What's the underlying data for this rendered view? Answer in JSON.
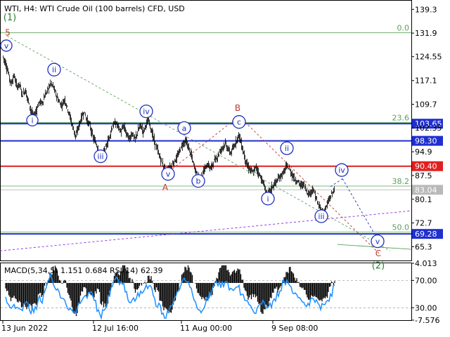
{
  "header": {
    "title": "WTI, H4:  WTI Crude Oil (100 barrels) CFD, USD"
  },
  "colors": {
    "candles": "#000000",
    "grid": "#c8c8c8",
    "fib": "#5aa05a",
    "wave_label": "#2030c0",
    "wave_big": "#2e7d32",
    "corr_label": "#c0392b",
    "blue_level": "#1f2fd0",
    "red_level": "#e02020",
    "macd_hist": "#000000",
    "macd_signal": "#e02020",
    "rsi": "#1e90ff",
    "tag_blue": "#1f2fd0",
    "tag_red": "#e02020",
    "tag_gray": "#b9b9b9"
  },
  "chart_data": [
    {
      "type": "candlestick",
      "title": "WTI, H4:  WTI Crude Oil (100 barrels) CFD, USD",
      "ylim": [
        61,
        142
      ],
      "y_ticks": [
        139.3,
        131.9,
        124.55,
        117.1,
        109.7,
        102.35,
        94.9,
        87.5,
        80.1,
        72.7,
        65.3
      ],
      "x_tick_labels": [
        "13 Jun 2022",
        "12 Jul 16:00",
        "11 Aug 00:00",
        "9 Sep 08:00"
      ],
      "price_path": [
        [
          0,
          124.8
        ],
        [
          4,
          122.5
        ],
        [
          8,
          119.5
        ],
        [
          12,
          116.0
        ],
        [
          16,
          118.8
        ],
        [
          20,
          115.2
        ],
        [
          24,
          116.0
        ],
        [
          28,
          112.5
        ],
        [
          32,
          114.2
        ],
        [
          36,
          111.0
        ],
        [
          40,
          108.0
        ],
        [
          44,
          105.5
        ],
        [
          48,
          108.0
        ],
        [
          52,
          110.5
        ],
        [
          56,
          110.0
        ],
        [
          60,
          112.4
        ],
        [
          64,
          114.2
        ],
        [
          68,
          116.2
        ],
        [
          72,
          115.2
        ],
        [
          76,
          112.6
        ],
        [
          80,
          110.5
        ],
        [
          84,
          109.3
        ],
        [
          88,
          111.3
        ],
        [
          92,
          108.6
        ],
        [
          96,
          105.6
        ],
        [
          100,
          102.4
        ],
        [
          104,
          99.6
        ],
        [
          108,
          102.8
        ],
        [
          112,
          105.6
        ],
        [
          116,
          107.4
        ],
        [
          120,
          104.6
        ],
        [
          124,
          103.1
        ],
        [
          128,
          99.6
        ],
        [
          132,
          97.8
        ],
        [
          136,
          95.8
        ],
        [
          140,
          92.6
        ],
        [
          144,
          94.6
        ],
        [
          148,
          97.0
        ],
        [
          152,
          99.8
        ],
        [
          156,
          102.8
        ],
        [
          160,
          103.9
        ],
        [
          164,
          103.0
        ],
        [
          168,
          101.0
        ],
        [
          172,
          102.9
        ],
        [
          176,
          100.6
        ],
        [
          180,
          98.8
        ],
        [
          184,
          100.8
        ],
        [
          188,
          98.6
        ],
        [
          192,
          101.2
        ],
        [
          196,
          103.2
        ],
        [
          200,
          101.1
        ],
        [
          204,
          103.6
        ],
        [
          208,
          104.6
        ],
        [
          212,
          101.0
        ],
        [
          216,
          97.9
        ],
        [
          220,
          95.6
        ],
        [
          224,
          92.8
        ],
        [
          228,
          90.8
        ],
        [
          232,
          88.6
        ],
        [
          236,
          89.6
        ],
        [
          240,
          90.4
        ],
        [
          244,
          91.9
        ],
        [
          248,
          93.1
        ],
        [
          252,
          95.4
        ],
        [
          256,
          97.4
        ],
        [
          260,
          98.3
        ],
        [
          264,
          96.4
        ],
        [
          268,
          93.9
        ],
        [
          272,
          90.6
        ],
        [
          276,
          88.1
        ],
        [
          280,
          86.6
        ],
        [
          284,
          87.6
        ],
        [
          288,
          89.9
        ],
        [
          292,
          90.9
        ],
        [
          296,
          89.6
        ],
        [
          300,
          91.9
        ],
        [
          304,
          92.8
        ],
        [
          308,
          94.6
        ],
        [
          312,
          96.1
        ],
        [
          316,
          97.5
        ],
        [
          320,
          95.9
        ],
        [
          324,
          94.4
        ],
        [
          328,
          96.0
        ],
        [
          332,
          98.3
        ],
        [
          336,
          100.2
        ],
        [
          340,
          96.8
        ],
        [
          344,
          93.3
        ],
        [
          348,
          90.3
        ],
        [
          352,
          89.3
        ],
        [
          356,
          88.3
        ],
        [
          360,
          90.1
        ],
        [
          364,
          88.4
        ],
        [
          368,
          86.4
        ],
        [
          372,
          84.2
        ],
        [
          376,
          81.2
        ],
        [
          380,
          82.8
        ],
        [
          384,
          84.1
        ],
        [
          388,
          85.3
        ],
        [
          392,
          86.4
        ],
        [
          396,
          87.5
        ],
        [
          400,
          88.6
        ],
        [
          404,
          90.5
        ],
        [
          408,
          89.3
        ],
        [
          412,
          87.6
        ],
        [
          416,
          86.1
        ],
        [
          420,
          85.7
        ],
        [
          424,
          84.3
        ],
        [
          428,
          84.9
        ],
        [
          432,
          82.8
        ],
        [
          436,
          81.6
        ],
        [
          440,
          83.2
        ],
        [
          444,
          81.8
        ],
        [
          448,
          78.6
        ],
        [
          452,
          77.0
        ],
        [
          456,
          75.8
        ],
        [
          460,
          77.6
        ],
        [
          464,
          79.8
        ],
        [
          468,
          81.7
        ],
        [
          472,
          83.4
        ]
      ],
      "fib_levels": [
        {
          "label": "0.0",
          "price": 132.0
        },
        {
          "label": "23.6",
          "price": 104.0
        },
        {
          "label": "38.2",
          "price": 84.2
        },
        {
          "label": "50.0",
          "price": 69.9
        }
      ],
      "horizontal_levels": [
        {
          "price": 103.65,
          "label": "103.65",
          "color": "blue"
        },
        {
          "price": 98.3,
          "label": "98.30",
          "color": "blue"
        },
        {
          "price": 90.4,
          "label": "90.40",
          "color": "red"
        },
        {
          "price": 83.04,
          "label": "83.04",
          "color": "gray"
        },
        {
          "price": 69.28,
          "label": "69.28",
          "color": "blue"
        }
      ],
      "wave_labels": [
        {
          "text": "(1)",
          "style": "big-green"
        },
        {
          "text": "5",
          "style": "red"
        },
        {
          "text": "v",
          "style": "circle"
        },
        {
          "text": "ii",
          "style": "circle"
        },
        {
          "text": "i",
          "style": "circle"
        },
        {
          "text": "iii",
          "style": "circle"
        },
        {
          "text": "iv",
          "style": "circle"
        },
        {
          "text": "v",
          "style": "circle"
        },
        {
          "text": "A",
          "style": "red"
        },
        {
          "text": "a",
          "style": "circle"
        },
        {
          "text": "b",
          "style": "circle"
        },
        {
          "text": "c",
          "style": "circle"
        },
        {
          "text": "B",
          "style": "red"
        },
        {
          "text": "ii",
          "style": "circle"
        },
        {
          "text": "i",
          "style": "circle"
        },
        {
          "text": "iii",
          "style": "circle"
        },
        {
          "text": "iv",
          "style": "circle"
        },
        {
          "text": "v",
          "style": "circle"
        },
        {
          "text": "C",
          "style": "red"
        },
        {
          "text": "(2)",
          "style": "big-green"
        }
      ]
    },
    {
      "type": "macd_rsi",
      "title": "MACD(5,34,5) 1.151 0.684 RSI(14) 62.39",
      "ylim": [
        -7.576,
        4.013
      ],
      "y_ticks": [
        {
          "label": "4.013",
          "value": 4.013
        },
        {
          "label": "70.00",
          "value": 70
        },
        {
          "label": "30.00",
          "value": 30
        },
        {
          "label": "-7.576",
          "value": -7.576
        }
      ],
      "rsi_range": [
        12,
        95
      ]
    }
  ]
}
